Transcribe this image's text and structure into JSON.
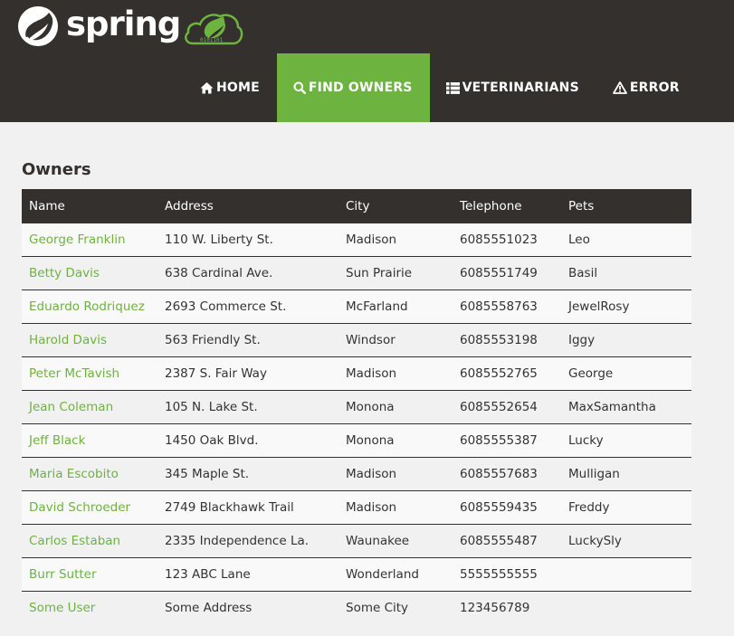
{
  "brand": {
    "name": "spring"
  },
  "nav": {
    "items": [
      {
        "label": "HOME",
        "icon": "home-icon"
      },
      {
        "label": "FIND OWNERS",
        "icon": "search-icon",
        "active": true
      },
      {
        "label": "VETERINARIANS",
        "icon": "list-icon"
      },
      {
        "label": "ERROR",
        "icon": "warning-icon"
      }
    ]
  },
  "colors": {
    "navbar": "#34302d",
    "accent": "#6db33f",
    "page_bg": "#f1f1f1"
  },
  "main": {
    "title": "Owners",
    "table": {
      "headers": [
        "Name",
        "Address",
        "City",
        "Telephone",
        "Pets"
      ],
      "rows": [
        [
          "George Franklin",
          "110 W. Liberty St.",
          "Madison",
          "6085551023",
          "Leo"
        ],
        [
          "Betty Davis",
          "638 Cardinal Ave.",
          "Sun Prairie",
          "6085551749",
          "Basil"
        ],
        [
          "Eduardo Rodriquez",
          "2693 Commerce St.",
          "McFarland",
          "6085558763",
          "JewelRosy"
        ],
        [
          "Harold Davis",
          "563 Friendly St.",
          "Windsor",
          "6085553198",
          "Iggy"
        ],
        [
          "Peter McTavish",
          "2387 S. Fair Way",
          "Madison",
          "6085552765",
          "George"
        ],
        [
          "Jean Coleman",
          "105 N. Lake St.",
          "Monona",
          "6085552654",
          "MaxSamantha"
        ],
        [
          "Jeff Black",
          "1450 Oak Blvd.",
          "Monona",
          "6085555387",
          "Lucky"
        ],
        [
          "Maria Escobito",
          "345 Maple St.",
          "Madison",
          "6085557683",
          "Mulligan"
        ],
        [
          "David Schroeder",
          "2749 Blackhawk Trail",
          "Madison",
          "6085559435",
          "Freddy"
        ],
        [
          "Carlos Estaban",
          "2335 Independence La.",
          "Waunakee",
          "6085555487",
          "LuckySly"
        ],
        [
          "Burr Sutter",
          "123 ABC Lane",
          "Wonderland",
          "5555555555",
          ""
        ],
        [
          "Some User",
          "Some Address",
          "Some City",
          "123456789",
          ""
        ]
      ]
    }
  }
}
